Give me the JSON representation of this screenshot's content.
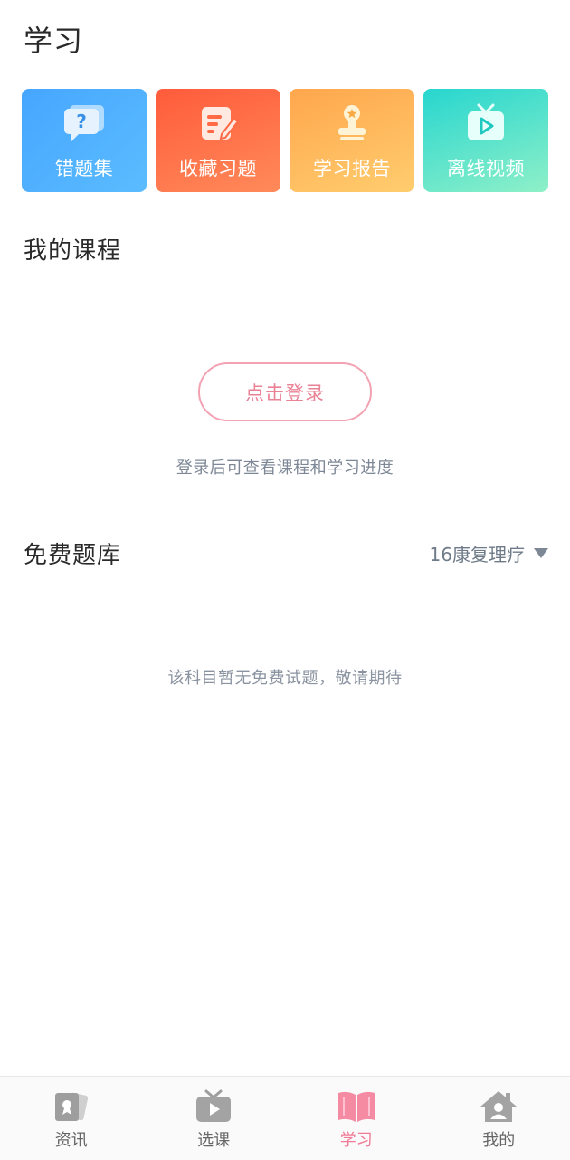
{
  "page": {
    "title": "学习"
  },
  "quick_actions": [
    {
      "label": "错题集",
      "icon": "question-bubble-icon"
    },
    {
      "label": "收藏习题",
      "icon": "edit-note-icon"
    },
    {
      "label": "学习报告",
      "icon": "stamp-badge-icon"
    },
    {
      "label": "离线视频",
      "icon": "tv-play-icon"
    }
  ],
  "my_courses": {
    "title": "我的课程",
    "login_button": "点击登录",
    "hint": "登录后可查看课程和学习进度"
  },
  "free_bank": {
    "title": "免费题库",
    "selected_subject": "16康复理疗",
    "empty_hint": "该科目暂无免费试题，敬请期待"
  },
  "tabbar": {
    "active": "学习",
    "items": [
      {
        "label": "资讯",
        "icon": "news-cards-icon"
      },
      {
        "label": "选课",
        "icon": "tv-play-icon"
      },
      {
        "label": "学习",
        "icon": "open-book-icon"
      },
      {
        "label": "我的",
        "icon": "home-user-icon"
      }
    ]
  },
  "colors": {
    "accent": "#f07b97",
    "login_border": "#f2a2b2",
    "card_wrong": "#46a6ff",
    "card_fav": "#ff5b3b",
    "card_report": "#ffa64d",
    "card_offline": "#27d6cf"
  }
}
